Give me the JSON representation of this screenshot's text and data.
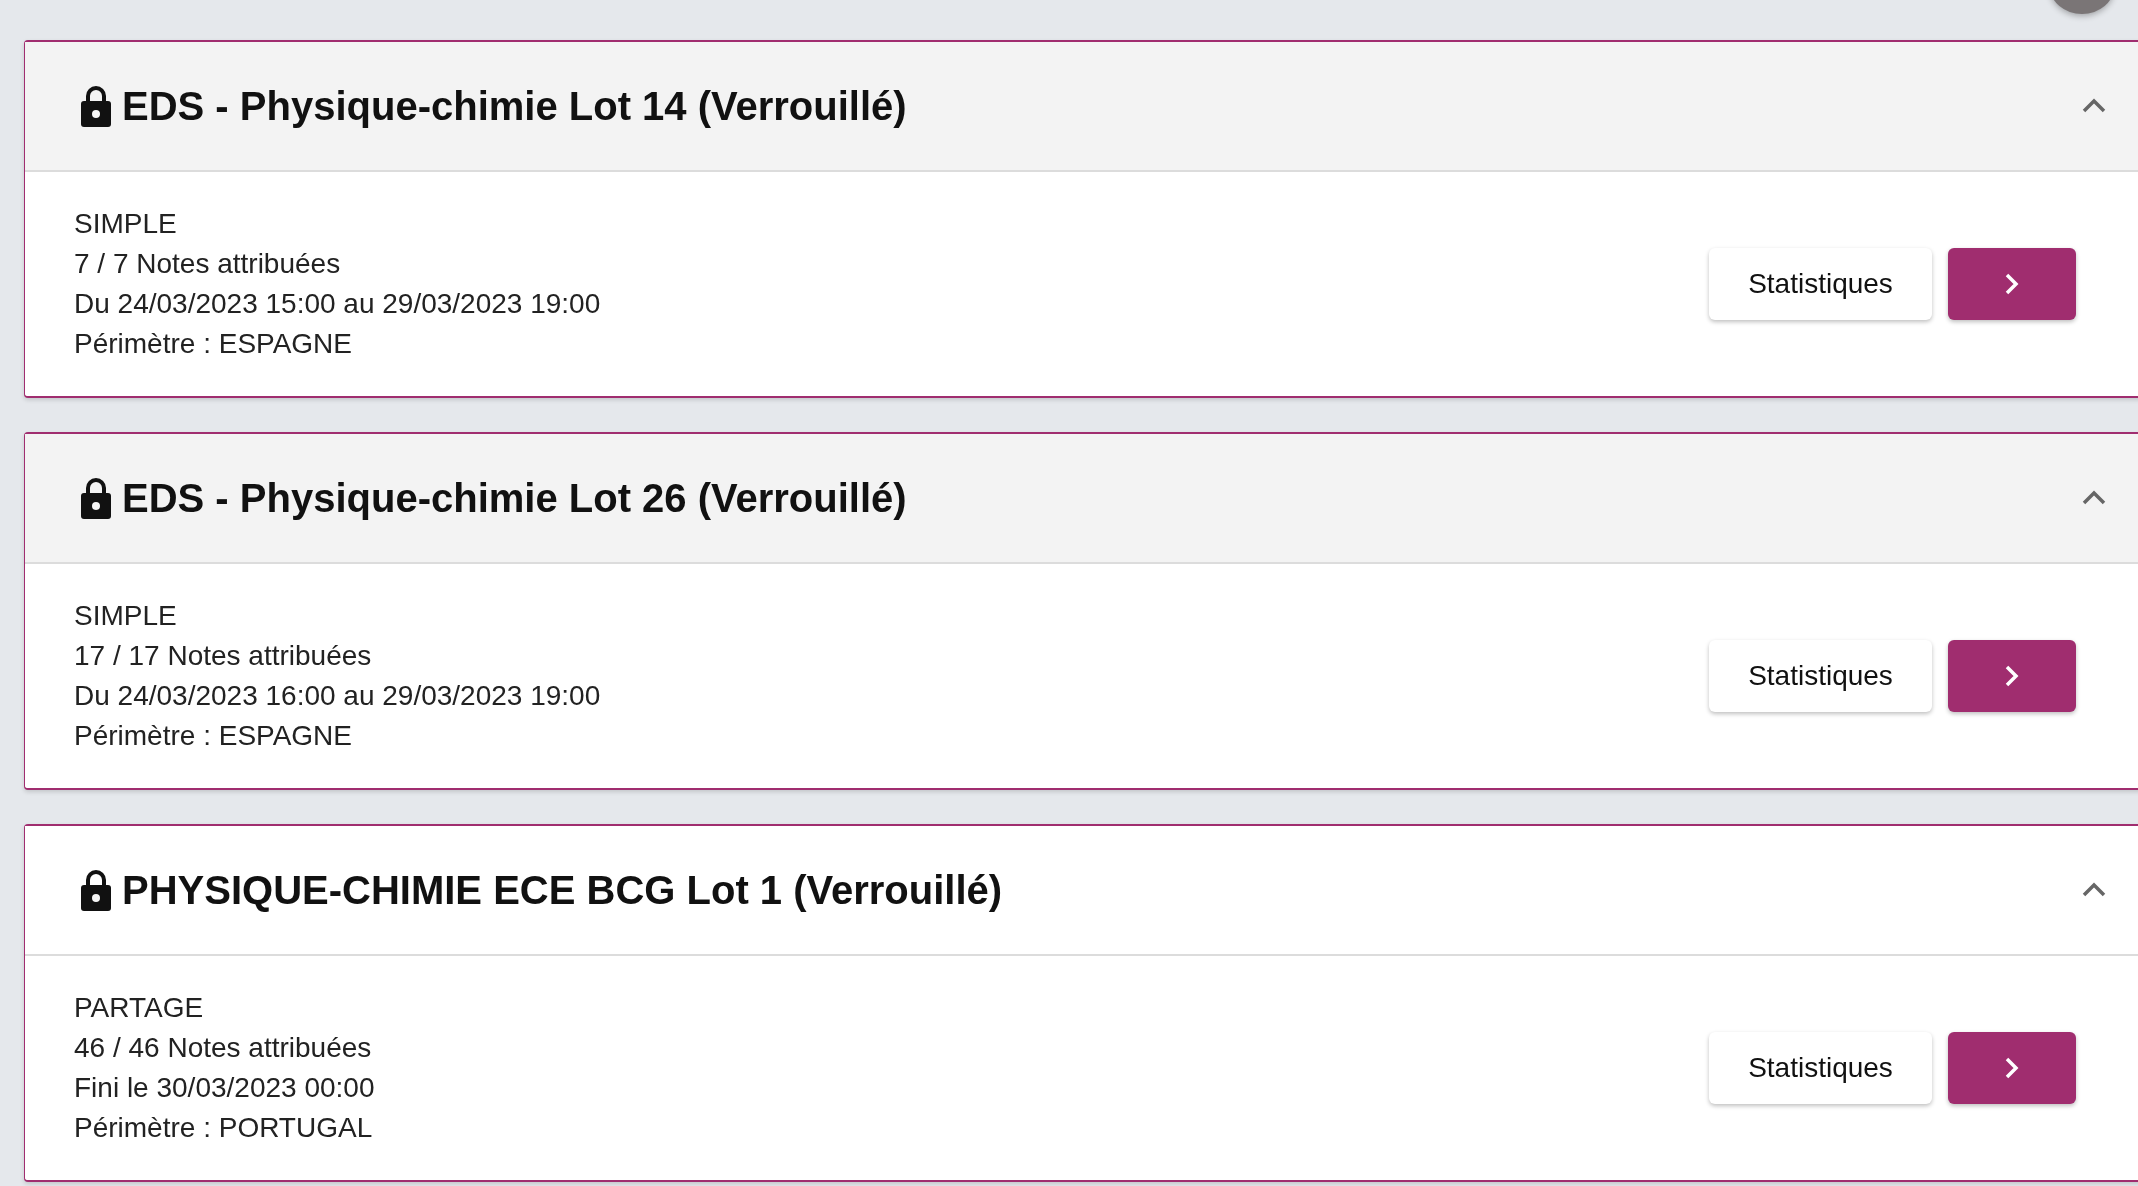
{
  "cards": [
    {
      "title": "EDS - Physique-chimie Lot 14 (Verrouillé)",
      "locked": true,
      "expanded": true,
      "highlighted": false,
      "lines": [
        "SIMPLE",
        "7 / 7 Notes attribuées",
        "Du 24/03/2023 15:00 au 29/03/2023 19:00",
        "Périmètre : ESPAGNE"
      ],
      "stats_label": "Statistiques"
    },
    {
      "title": "EDS - Physique-chimie Lot 26 (Verrouillé)",
      "locked": true,
      "expanded": true,
      "highlighted": false,
      "lines": [
        "SIMPLE",
        "17 / 17 Notes attribuées",
        "Du 24/03/2023 16:00 au 29/03/2023 19:00",
        "Périmètre : ESPAGNE"
      ],
      "stats_label": "Statistiques"
    },
    {
      "title": "PHYSIQUE-CHIMIE ECE BCG Lot 1 (Verrouillé)",
      "locked": true,
      "expanded": true,
      "highlighted": true,
      "lines": [
        "PARTAGE",
        "46 / 46 Notes attribuées",
        "Fini le 30/03/2023 00:00",
        "Périmètre : PORTUGAL"
      ],
      "stats_label": "Statistiques"
    }
  ]
}
